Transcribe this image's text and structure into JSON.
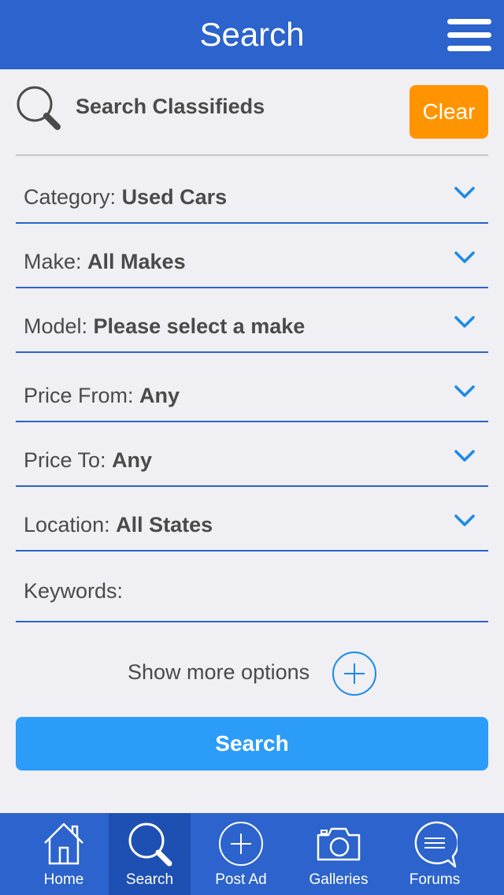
{
  "header": {
    "title": "Search"
  },
  "search": {
    "label": "Search Classifieds",
    "clear_label": "Clear"
  },
  "fields": [
    {
      "label": "Category: ",
      "value": "Used Cars"
    },
    {
      "label": "Make: ",
      "value": "All Makes"
    },
    {
      "label": "Model: ",
      "value": "Please select a make"
    },
    {
      "label": "Price From: ",
      "value": "Any"
    },
    {
      "label": "Price To: ",
      "value": "Any"
    },
    {
      "label": "Location: ",
      "value": "All States"
    }
  ],
  "keywords": {
    "label": "Keywords:"
  },
  "more_options": {
    "label": "Show more options"
  },
  "search_button": {
    "label": "Search"
  },
  "tabbar": {
    "active": "Search",
    "items": [
      {
        "label": "Home",
        "icon": "home-icon"
      },
      {
        "label": "Search",
        "icon": "search-icon"
      },
      {
        "label": "Post Ad",
        "icon": "plus-circle-icon"
      },
      {
        "label": "Galleries",
        "icon": "camera-icon"
      },
      {
        "label": "Forums",
        "icon": "chat-bubble-icon"
      }
    ]
  },
  "colors": {
    "brand_blue": "#2c63cc",
    "accent_orange": "#ff9400",
    "button_blue": "#2c9cf9",
    "chevron_blue": "#1a8ae8"
  }
}
